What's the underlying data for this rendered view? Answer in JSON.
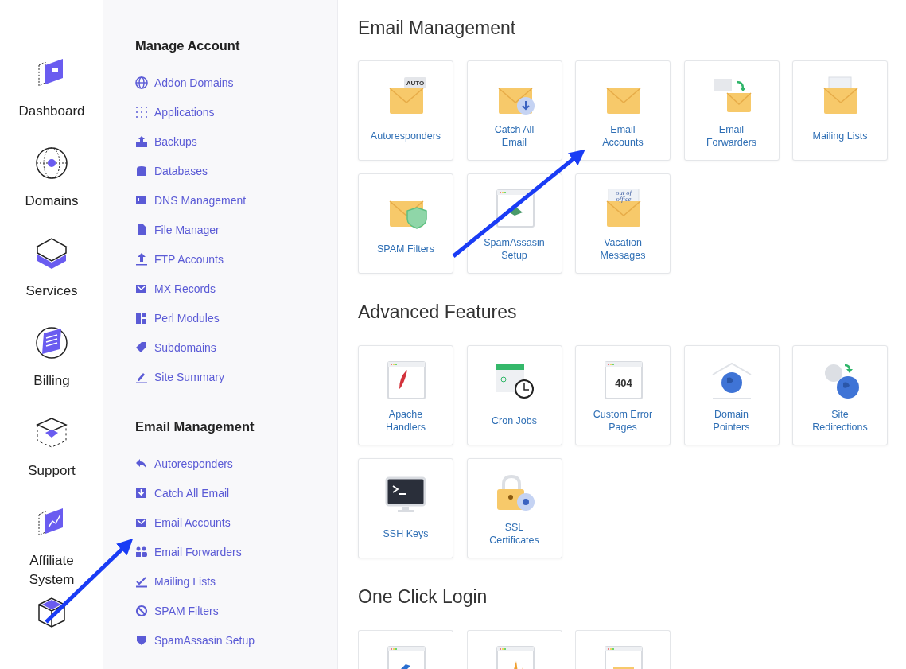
{
  "rail": {
    "items": [
      {
        "label": "Dashboard"
      },
      {
        "label": "Domains"
      },
      {
        "label": "Services"
      },
      {
        "label": "Billing"
      },
      {
        "label": "Support"
      },
      {
        "label": "Affiliate System"
      }
    ]
  },
  "menu": {
    "sections": [
      {
        "title": "Manage Account",
        "items": [
          "Addon Domains",
          "Applications",
          "Backups",
          "Databases",
          "DNS Management",
          "File Manager",
          "FTP Accounts",
          "MX Records",
          "Perl Modules",
          "Subdomains",
          "Site Summary"
        ]
      },
      {
        "title": "Email Management",
        "items": [
          "Autoresponders",
          "Catch All Email",
          "Email Accounts",
          "Email Forwarders",
          "Mailing Lists",
          "SPAM Filters",
          "SpamAssasin Setup"
        ]
      }
    ]
  },
  "main": {
    "sections": [
      {
        "title": "Email Management",
        "tiles": [
          {
            "label": "Autoresponders",
            "icon_text": "AUTO"
          },
          {
            "label": "Catch All\nEmail"
          },
          {
            "label": "Email\nAccounts"
          },
          {
            "label": "Email\nForwarders"
          },
          {
            "label": "Mailing Lists"
          },
          {
            "label": "SPAM Filters"
          },
          {
            "label": "SpamAssasin\nSetup"
          },
          {
            "label": "Vacation\nMessages",
            "icon_text": "out of office"
          }
        ]
      },
      {
        "title": "Advanced Features",
        "tiles": [
          {
            "label": "Apache\nHandlers"
          },
          {
            "label": "Cron Jobs"
          },
          {
            "label": "Custom Error\nPages",
            "icon_text": "404"
          },
          {
            "label": "Domain\nPointers"
          },
          {
            "label": "Site\nRedirections"
          },
          {
            "label": "SSH Keys"
          },
          {
            "label": "SSL\nCertificates"
          }
        ]
      },
      {
        "title": "One Click Login"
      }
    ]
  }
}
